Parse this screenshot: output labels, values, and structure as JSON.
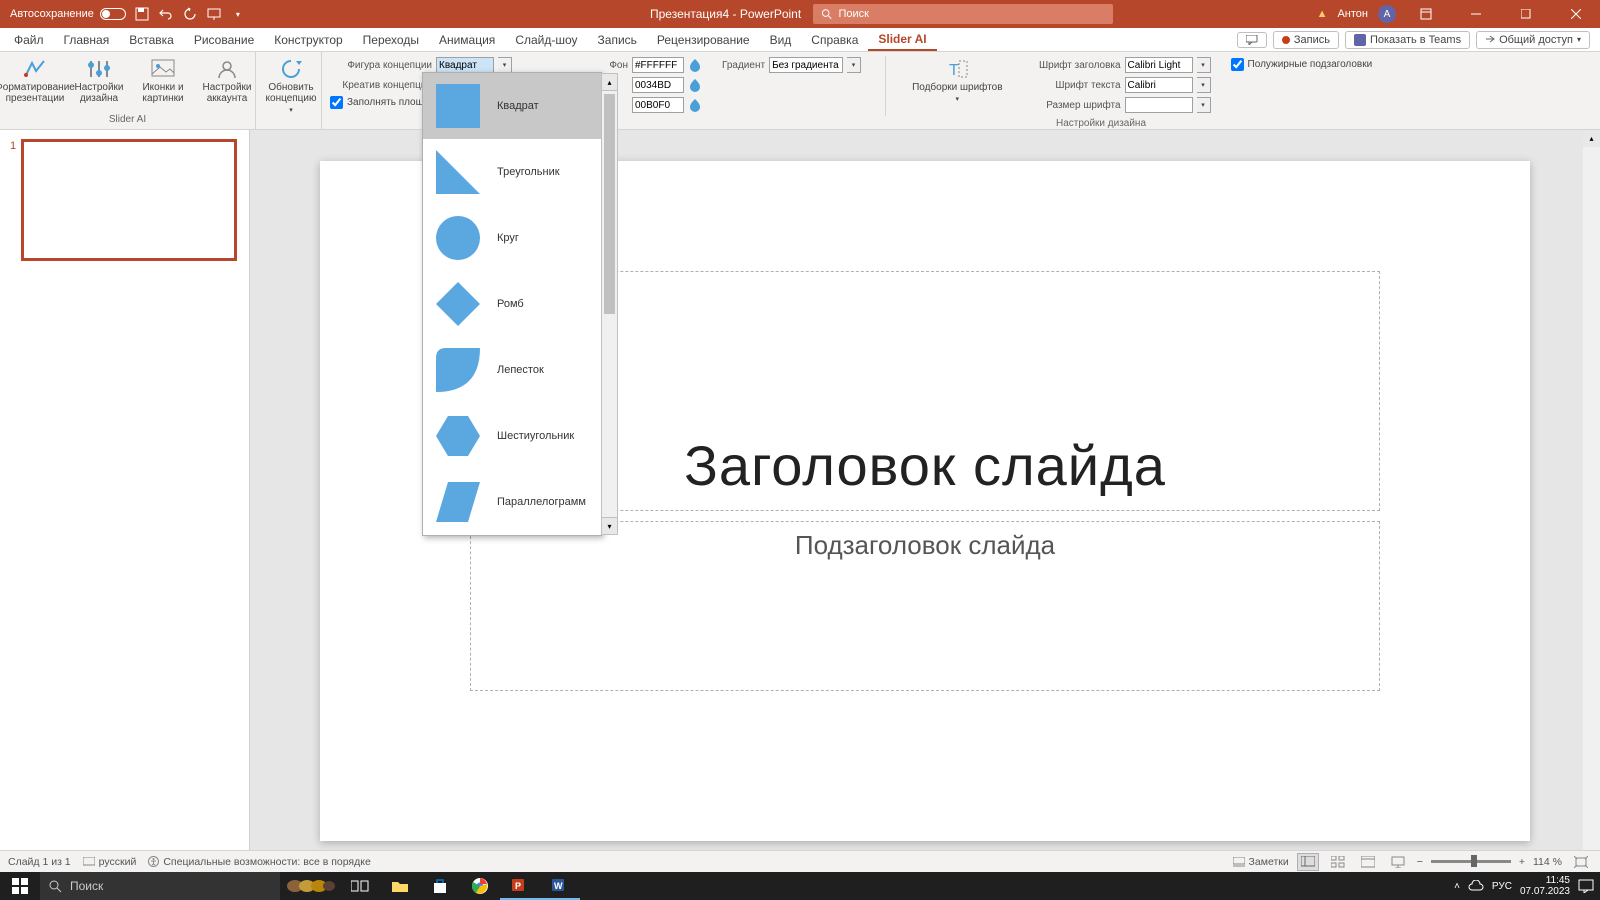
{
  "titlebar": {
    "autosave": "Автосохранение",
    "doc_title": "Презентация4 - PowerPoint",
    "search_placeholder": "Поиск",
    "user": "Антон",
    "avatar_letter": "А"
  },
  "tabs": {
    "items": [
      "Файл",
      "Главная",
      "Вставка",
      "Рисование",
      "Конструктор",
      "Переходы",
      "Анимация",
      "Слайд-шоу",
      "Запись",
      "Рецензирование",
      "Вид",
      "Справка",
      "Slider AI"
    ],
    "active_index": 12,
    "record": "Запись",
    "teams": "Показать в Teams",
    "share": "Общий доступ"
  },
  "ribbon": {
    "group1_label": "Slider AI",
    "format_pres": "Форматирование презентации",
    "design_settings": "Настройки дизайна",
    "icons_pics": "Иконки и картинки",
    "account_settings": "Настройки аккаунта",
    "update_concept": "Обновить концепцию",
    "concept_shape_label": "Фигура концепции",
    "concept_shape_value": "Квадрат",
    "creative_label": "Креатив концепции",
    "fill_area": "Заполнять площ",
    "bg_label": "Фон",
    "bg_value": "#FFFFFF",
    "color2": "0034BD",
    "color3": "00B0F0",
    "gradient_label": "Градиент",
    "gradient_value": "Без градиента",
    "group3_label": "Настройки дизайна",
    "font_selections": "Подборки шрифтов",
    "title_font_label": "Шрифт заголовка",
    "title_font_value": "Calibri Light",
    "text_font_label": "Шрифт текста",
    "text_font_value": "Calibri",
    "font_size_label": "Размер шрифта",
    "bold_subs": "Полужирные подзаголовки"
  },
  "dropdown": {
    "items": [
      {
        "label": "Квадрат",
        "shape": "square"
      },
      {
        "label": "Треугольник",
        "shape": "triangle"
      },
      {
        "label": "Круг",
        "shape": "circle"
      },
      {
        "label": "Ромб",
        "shape": "diamond"
      },
      {
        "label": "Лепесток",
        "shape": "petal"
      },
      {
        "label": "Шестиугольник",
        "shape": "hexagon"
      },
      {
        "label": "Параллелограмм",
        "shape": "parallelogram"
      }
    ]
  },
  "slide": {
    "number": "1",
    "title": "Заголовок слайда",
    "subtitle": "Подзаголовок слайда"
  },
  "statusbar": {
    "slide_count": "Слайд 1 из 1",
    "language": "русский",
    "accessibility": "Специальные возможности: все в порядке",
    "notes": "Заметки",
    "zoom": "114 %"
  },
  "taskbar": {
    "search": "Поиск",
    "time": "11:45",
    "date": "07.07.2023",
    "lang": "РУС"
  }
}
